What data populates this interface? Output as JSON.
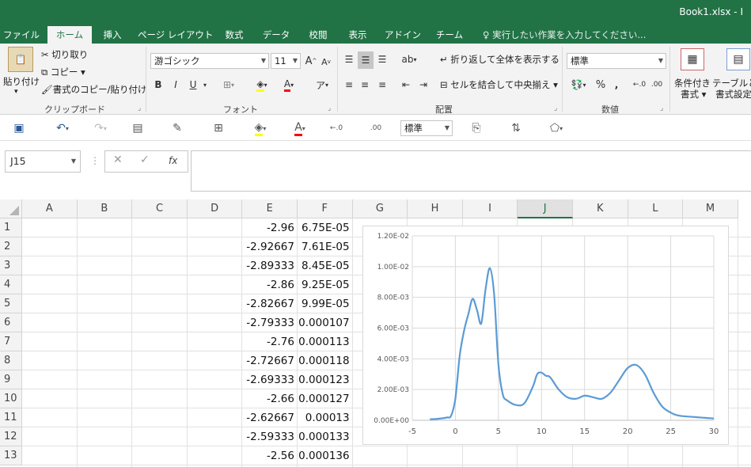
{
  "window": {
    "title": "Book1.xlsx - I"
  },
  "tabs": [
    {
      "label": "ファイル",
      "active": false
    },
    {
      "label": "ホーム",
      "active": true
    },
    {
      "label": "挿入",
      "active": false
    },
    {
      "label": "ページ レイアウト",
      "active": false
    },
    {
      "label": "数式",
      "active": false
    },
    {
      "label": "データ",
      "active": false
    },
    {
      "label": "校閲",
      "active": false
    },
    {
      "label": "表示",
      "active": false
    },
    {
      "label": "アドイン",
      "active": false
    },
    {
      "label": "チーム",
      "active": false
    }
  ],
  "tell_me": "実行したい作業を入力してください...",
  "ribbon": {
    "clipboard": {
      "paste": "貼り付け",
      "cut": "切り取り",
      "copy": "コピー",
      "format_painter": "書式のコピー/貼り付け",
      "label": "クリップボード"
    },
    "font": {
      "font_name": "游ゴシック",
      "font_size": "11",
      "grow": "A",
      "shrink": "A",
      "bold": "B",
      "italic": "I",
      "underline": "U",
      "label": "フォント"
    },
    "alignment": {
      "wrap_text": "折り返して全体を表示する",
      "merge_center": "セルを結合して中央揃え",
      "label": "配置"
    },
    "number": {
      "format": "標準",
      "percent": "%",
      "comma": ",",
      "label": "数値"
    },
    "styles": {
      "conditional": "条件付き",
      "conditional_2": "書式",
      "table": "テーブルとし",
      "table_2": "書式設定"
    }
  },
  "qat": {
    "number_format": "標準"
  },
  "formula_bar": {
    "name_box": "J15",
    "formula": ""
  },
  "columns": [
    "A",
    "B",
    "C",
    "D",
    "E",
    "F",
    "G",
    "H",
    "I",
    "J",
    "K",
    "L",
    "M"
  ],
  "selected_column": "J",
  "rows": [
    {
      "num": "1",
      "e": "-2.96",
      "f": "6.75E-05"
    },
    {
      "num": "2",
      "e": "-2.92667",
      "f": "7.61E-05"
    },
    {
      "num": "3",
      "e": "-2.89333",
      "f": "8.45E-05"
    },
    {
      "num": "4",
      "e": "-2.86",
      "f": "9.25E-05"
    },
    {
      "num": "5",
      "e": "-2.82667",
      "f": "9.99E-05"
    },
    {
      "num": "6",
      "e": "-2.79333",
      "f": "0.000107"
    },
    {
      "num": "7",
      "e": "-2.76",
      "f": "0.000113"
    },
    {
      "num": "8",
      "e": "-2.72667",
      "f": "0.000118"
    },
    {
      "num": "9",
      "e": "-2.69333",
      "f": "0.000123"
    },
    {
      "num": "10",
      "e": "-2.66",
      "f": "0.000127"
    },
    {
      "num": "11",
      "e": "-2.62667",
      "f": "0.00013"
    },
    {
      "num": "12",
      "e": "-2.59333",
      "f": "0.000133"
    },
    {
      "num": "13",
      "e": "-2.56",
      "f": "0.000136"
    }
  ],
  "chart_data": {
    "type": "line",
    "title": "",
    "xlabel": "",
    "ylabel": "",
    "xlim": [
      -5,
      30
    ],
    "ylim": [
      0,
      0.012
    ],
    "x_ticks": [
      "-5",
      "0",
      "5",
      "10",
      "15",
      "20",
      "25",
      "30"
    ],
    "y_ticks": [
      "0.00E+00",
      "2.00E-03",
      "4.00E-03",
      "6.00E-03",
      "8.00E-03",
      "1.00E-02",
      "1.20E-02"
    ],
    "grid": true,
    "legend": "none",
    "color": "#5b9bd5",
    "series": [
      {
        "x": [
          -2.96,
          -2,
          -1,
          -0.5,
          0,
          0.5,
          1,
          1.5,
          2,
          2.5,
          3,
          3.5,
          4,
          4.5,
          5,
          5.5,
          6,
          7,
          8,
          9,
          9.5,
          10,
          10.5,
          11,
          12,
          13,
          14,
          15,
          16,
          17,
          18,
          19,
          20,
          21,
          22,
          23,
          24,
          25,
          26,
          28,
          30
        ],
        "y": [
          6.75e-05,
          0.0001,
          0.00018,
          0.0003,
          0.0014,
          0.0042,
          0.0058,
          0.0069,
          0.0079,
          0.0072,
          0.0063,
          0.0085,
          0.0099,
          0.0082,
          0.0036,
          0.0017,
          0.0013,
          0.001,
          0.0011,
          0.0022,
          0.003,
          0.0031,
          0.0029,
          0.0028,
          0.002,
          0.0015,
          0.0014,
          0.0016,
          0.0015,
          0.0014,
          0.0018,
          0.0026,
          0.0034,
          0.0036,
          0.003,
          0.0018,
          0.0009,
          0.0005,
          0.0003,
          0.0002,
          0.00012
        ]
      }
    ]
  }
}
